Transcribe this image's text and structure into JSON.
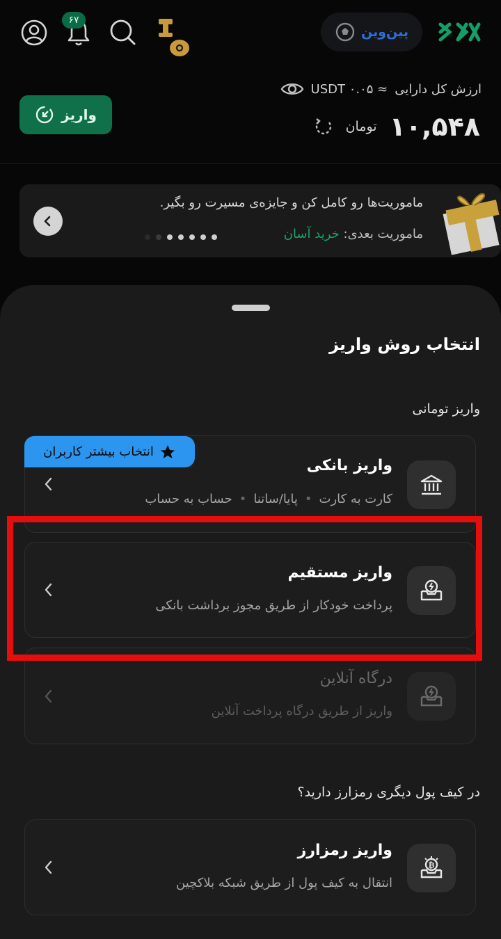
{
  "topbar": {
    "notification_count": "۶۷",
    "promo_label": "پین‌وین",
    "logo_text": "XX"
  },
  "balance": {
    "label": "ارزش کل دارایی",
    "usdt_value": "≈ USDT ۰.۰۵",
    "amount": "۱۰,۵۴۸",
    "unit": "تومان",
    "deposit_label": "واریز"
  },
  "mission": {
    "text": "ماموریت‌ها رو کامل کن و جایزه‌ی مسیرت رو بگیر.",
    "next_label": "ماموریت بعدی:",
    "next_link": "خرید آسان"
  },
  "sheet": {
    "title": "انتخاب روش واریز",
    "section_toman": "واریز تومانی",
    "section_crypto": "در کیف پول دیگری رمزارز دارید؟",
    "ribbon": "انتخاب بیشتر کاربران",
    "bank": {
      "title": "واریز بانکی",
      "sub1": "کارت به کارت",
      "sub2": "پایا/ساتنا",
      "sub3": "حساب به حساب"
    },
    "direct": {
      "title": "واریز مستقیم",
      "sub": "پرداخت خودکار از طریق مجوز برداشت بانکی"
    },
    "gateway": {
      "title": "درگاه آنلاین",
      "sub": "واریز از طریق درگاه پرداخت آنلاین"
    },
    "crypto": {
      "title": "واریز رمزارز",
      "sub": "انتقال به کیف پول از طریق شبکه بلاکچین"
    }
  },
  "colors": {
    "accent_green": "#10704a",
    "highlight_red": "#e50e0e",
    "ribbon_blue": "#2b95f0"
  }
}
